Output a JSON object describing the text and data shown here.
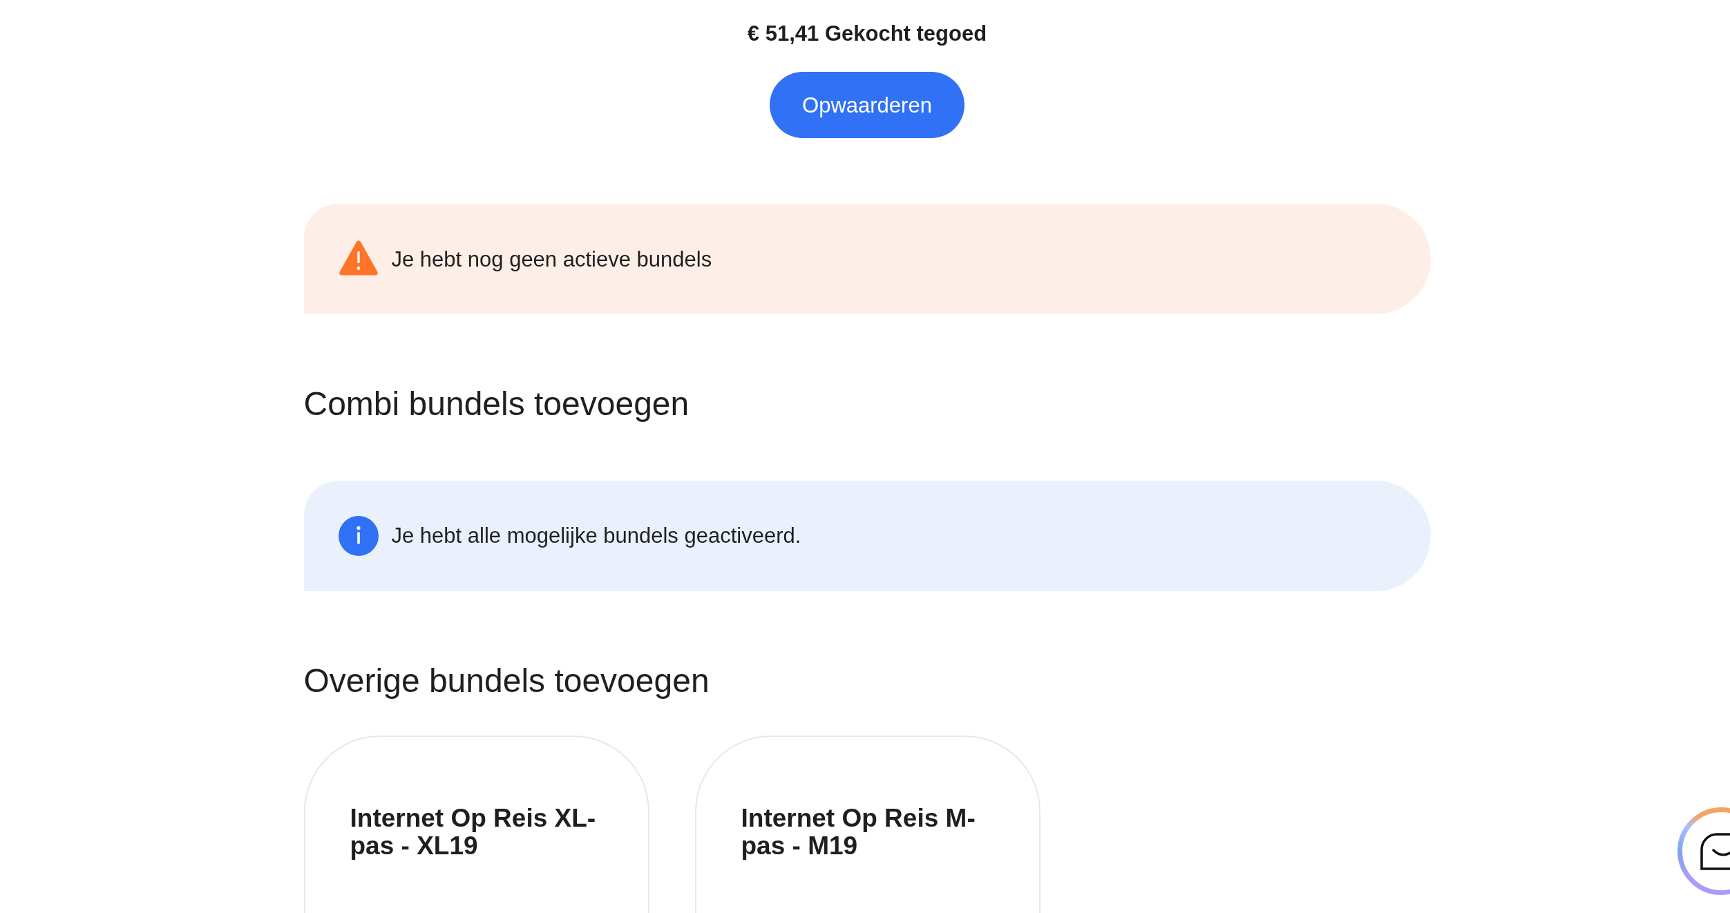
{
  "credit": {
    "text": "€ 51,41 Gekocht tegoed"
  },
  "topup_button": {
    "label": "Opwaarderen"
  },
  "sections": [
    {
      "alert": {
        "kind": "warning",
        "text": "Je hebt nog geen actieve bundels"
      }
    },
    {
      "title": "Combi bundels toevoegen",
      "alert": {
        "kind": "info",
        "text": "Je hebt alle mogelijke bundels geactiveerd."
      }
    },
    {
      "title": "Overige bundels toevoegen",
      "bundles": [
        {
          "name": "Internet Op Reis XL-pas - XL19"
        },
        {
          "name": "Internet Op Reis M-pas - M19"
        }
      ]
    }
  ]
}
